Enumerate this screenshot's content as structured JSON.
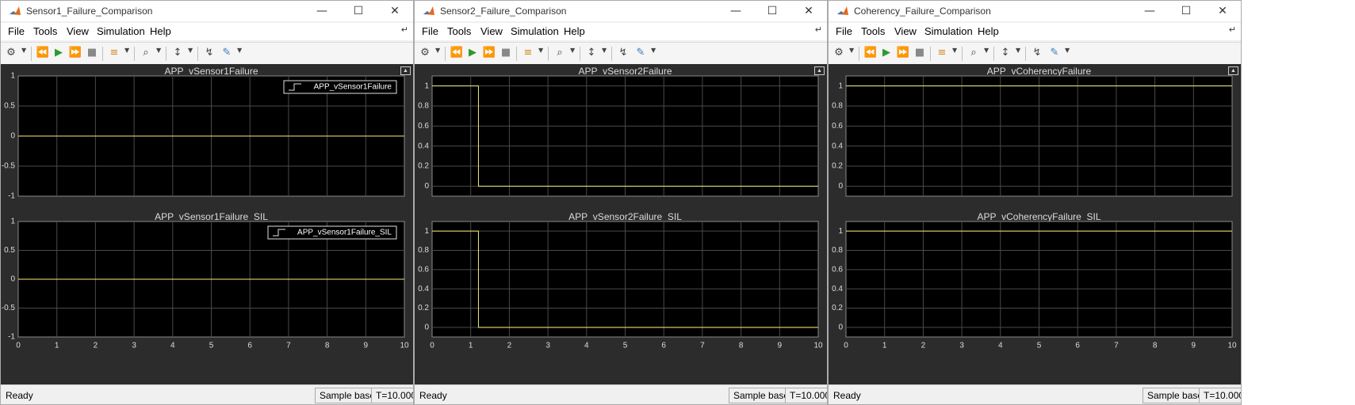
{
  "windows": [
    {
      "title": "Sensor1_Failure_Comparison",
      "menu": [
        "File",
        "Tools",
        "View",
        "Simulation",
        "Help"
      ],
      "status": "Ready",
      "sample_mode": "Sample based",
      "time": "T=10.000",
      "plots": [
        {
          "title": "APP_vSensor1Failure",
          "yticks": [
            "1",
            "0.5",
            "0",
            "-0.5",
            "-1"
          ],
          "xticks": [],
          "legend": "APP_vSensor1Failure"
        },
        {
          "title": "APP_vSensor1Failure_SIL",
          "yticks": [
            "1",
            "0.5",
            "0",
            "-0.5",
            "-1"
          ],
          "xticks": [
            "0",
            "1",
            "2",
            "3",
            "4",
            "5",
            "6",
            "7",
            "8",
            "9",
            "10"
          ],
          "legend": "APP_vSensor1Failure_SIL"
        }
      ]
    },
    {
      "title": "Sensor2_Failure_Comparison",
      "menu": [
        "File",
        "Tools",
        "View",
        "Simulation",
        "Help"
      ],
      "status": "Ready",
      "sample_mode": "Sample based",
      "time": "T=10.000",
      "plots": [
        {
          "title": "APP_vSensor2Failure",
          "yticks": [
            "1",
            "0.8",
            "0.6",
            "0.4",
            "0.2",
            "0"
          ],
          "xticks": []
        },
        {
          "title": "APP_vSensor2Failure_SIL",
          "yticks": [
            "1",
            "0.8",
            "0.6",
            "0.4",
            "0.2",
            "0"
          ],
          "xticks": [
            "0",
            "1",
            "2",
            "3",
            "4",
            "5",
            "6",
            "7",
            "8",
            "9",
            "10"
          ]
        }
      ]
    },
    {
      "title": "Coherency_Failure_Comparison",
      "menu": [
        "File",
        "Tools",
        "View",
        "Simulation",
        "Help"
      ],
      "status": "Ready",
      "sample_mode": "Sample based",
      "time": "T=10.000",
      "plots": [
        {
          "title": "APP_vCoherencyFailure",
          "yticks": [
            "1",
            "0.8",
            "0.6",
            "0.4",
            "0.2",
            "0"
          ],
          "xticks": []
        },
        {
          "title": "APP_vCoherencyFailure_SIL",
          "yticks": [
            "1",
            "0.8",
            "0.6",
            "0.4",
            "0.2",
            "0"
          ],
          "xticks": [
            "0",
            "1",
            "2",
            "3",
            "4",
            "5",
            "6",
            "7",
            "8",
            "9",
            "10"
          ]
        }
      ]
    }
  ],
  "colors": {
    "trace": "#f2ee7a",
    "axes_bg": "#000000",
    "figure_bg": "#2c2c2c",
    "grid": "#4a4a4a",
    "axis_text": "#dcdcdc"
  },
  "chart_data": [
    {
      "type": "line",
      "title": "APP_vSensor1Failure",
      "x": [
        0,
        10
      ],
      "y": [
        0,
        0
      ],
      "xlim": [
        0,
        10
      ],
      "ylim": [
        -1,
        1
      ],
      "grid": true,
      "legend": "top-right",
      "series": [
        {
          "name": "APP_vSensor1Failure",
          "values": [
            0,
            0
          ]
        }
      ]
    },
    {
      "type": "line",
      "title": "APP_vSensor1Failure_SIL",
      "x": [
        0,
        10
      ],
      "y": [
        0,
        0
      ],
      "xlim": [
        0,
        10
      ],
      "ylim": [
        -1,
        1
      ],
      "grid": true,
      "legend": "top-right",
      "series": [
        {
          "name": "APP_vSensor1Failure_SIL",
          "values": [
            0,
            0
          ]
        }
      ]
    },
    {
      "type": "line",
      "title": "APP_vSensor2Failure",
      "x": [
        0,
        1.2,
        1.2,
        10
      ],
      "y": [
        1,
        1,
        0,
        0
      ],
      "xlim": [
        0,
        10
      ],
      "ylim": [
        -0.1,
        1.1
      ],
      "grid": true
    },
    {
      "type": "line",
      "title": "APP_vSensor2Failure_SIL",
      "x": [
        0,
        1.2,
        1.2,
        10
      ],
      "y": [
        1,
        1,
        0,
        0
      ],
      "xlim": [
        0,
        10
      ],
      "ylim": [
        -0.1,
        1.1
      ],
      "grid": true
    },
    {
      "type": "line",
      "title": "APP_vCoherencyFailure",
      "x": [
        0,
        10
      ],
      "y": [
        1,
        1
      ],
      "xlim": [
        0,
        10
      ],
      "ylim": [
        -0.1,
        1.1
      ],
      "grid": true
    },
    {
      "type": "line",
      "title": "APP_vCoherencyFailure_SIL",
      "x": [
        0,
        10
      ],
      "y": [
        1,
        1
      ],
      "xlim": [
        0,
        10
      ],
      "ylim": [
        -0.1,
        1.1
      ],
      "grid": true
    }
  ]
}
